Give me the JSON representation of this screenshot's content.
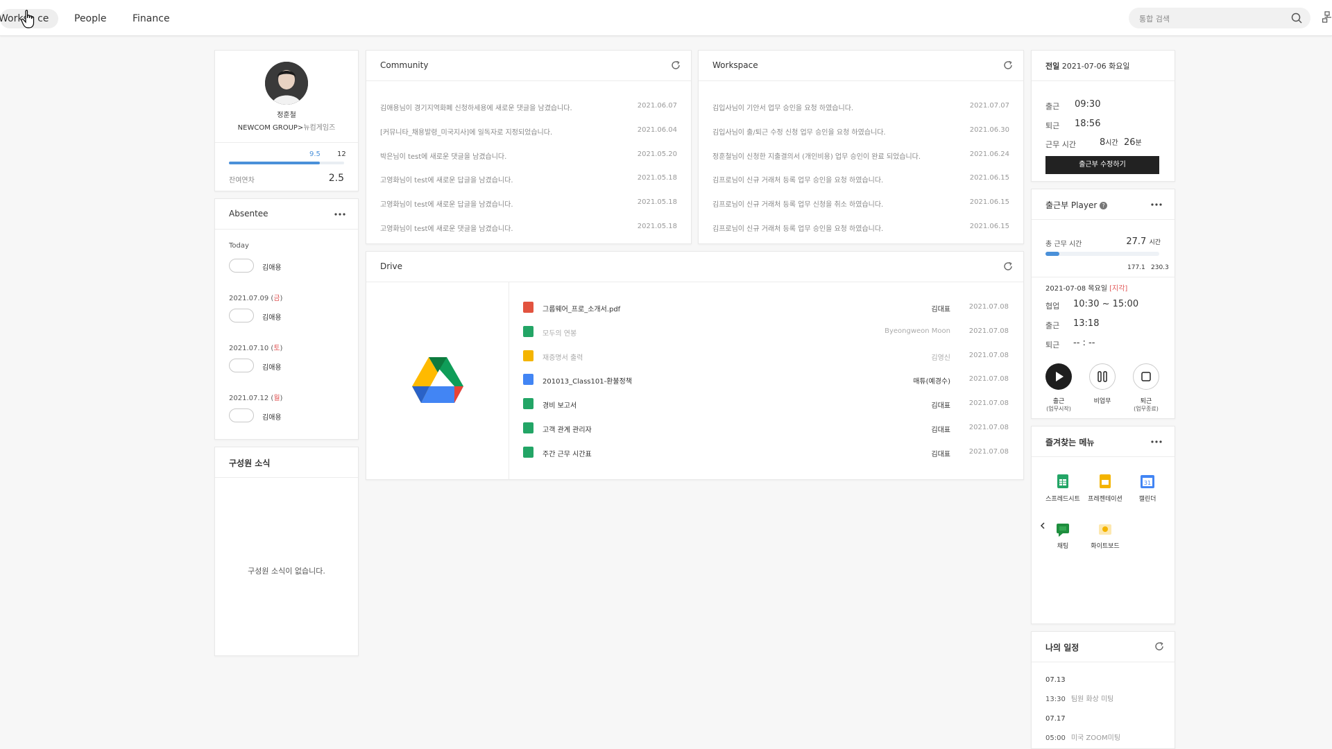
{
  "nav": {
    "tabs": [
      "Workspace",
      "People",
      "Finance"
    ],
    "active_visible": "Worksp ce"
  },
  "search": {
    "placeholder": "통합 검색"
  },
  "profile": {
    "name": "정훈철",
    "org": "NEWCOM GROUP>",
    "org_sub": "뉴컴게임즈",
    "leave_used": "9.5",
    "leave_total": "12",
    "leave_fraction": 0.79,
    "leave_label": "잔여연차",
    "leave_remaining": "2.5"
  },
  "absentee": {
    "title": "Absentee",
    "groups": [
      {
        "date": "Today",
        "date_suffix": "",
        "name": "김애용"
      },
      {
        "date": "2021.07.09 (",
        "date_suffix": "금",
        "date_close": ")",
        "name": "김애용"
      },
      {
        "date": "2021.07.10 (",
        "date_suffix": "토",
        "date_close": ")",
        "name": "김애용"
      },
      {
        "date": "2021.07.12 (",
        "date_suffix": "월",
        "date_close": ")",
        "name": "김애용"
      }
    ]
  },
  "news": {
    "title": "구성원 소식",
    "empty": "구성원 소식이 없습니다."
  },
  "community": {
    "title": "Community",
    "rows": [
      {
        "text": "김애용님이 경기지역화폐 신청하세용에 새로운 댓글을 남겼습니다.",
        "date": "2021.06.07"
      },
      {
        "text": "[커뮤니타_채용발령_미국지사]에 일독자로 지정되었습니다.",
        "date": "2021.06.04"
      },
      {
        "text": "박은님이 test에 새로운 댓글을 남겼습니다.",
        "date": "2021.05.20"
      },
      {
        "text": "고영화님이 test에 새로운 답글을 남겼습니다.",
        "date": "2021.05.18"
      },
      {
        "text": "고영화님이 test에 새로운 답글을 남겼습니다.",
        "date": "2021.05.18"
      },
      {
        "text": "고영화님이 test에 새로운 댓글을 남겼습니다.",
        "date": "2021.05.18"
      }
    ]
  },
  "workspace": {
    "title": "Workspace",
    "rows": [
      {
        "text": "김입사님이 기안서 업무 승인을 요청 하였습니다.",
        "date": "2021.07.07"
      },
      {
        "text": "김입사님이 출/퇴근 수정 신청 업무 승인을 요청 하였습니다.",
        "date": "2021.06.30"
      },
      {
        "text": "정훈철님이 신청한 지출결의서 (개인비용) 업무 승인이 완료 되었습니다.",
        "date": "2021.06.24"
      },
      {
        "text": "김프로님이 신규 거래처 등록 업무 승인을 요청 하였습니다.",
        "date": "2021.06.15"
      },
      {
        "text": "김프로님이 신규 거래처 등록 업무 신청을 취소 하였습니다.",
        "date": "2021.06.15"
      },
      {
        "text": "김프로님이 신규 거래처 등록 업무 승인을 요청 하였습니다.",
        "date": "2021.06.15"
      }
    ]
  },
  "drive": {
    "title": "Drive",
    "files": [
      {
        "icon": "pdf-file-icon",
        "name": "그룹웨어_프로_소개서.pdf",
        "owner": "김대표",
        "date": "2021.07.08",
        "dim": false,
        "color": "#e2533f"
      },
      {
        "icon": "sheets-file-icon",
        "name": "모두의 연봉",
        "owner": "Byeongweon Moon",
        "date": "2021.07.08",
        "dim": true,
        "color": "#23a566"
      },
      {
        "icon": "slides-file-icon",
        "name": "재증명서 출력",
        "owner": "김영신",
        "date": "2021.07.08",
        "dim": true,
        "color": "#f4b400"
      },
      {
        "icon": "docs-file-icon",
        "name": "201013_Class101-환불정책",
        "owner": "매튜(예경수)",
        "date": "2021.07.08",
        "dim": false,
        "color": "#4285f4"
      },
      {
        "icon": "sheets-file-icon",
        "name": "경비 보고서",
        "owner": "김대표",
        "date": "2021.07.08",
        "dim": false,
        "color": "#23a566"
      },
      {
        "icon": "sheets-file-icon",
        "name": "고객 관계 관리자",
        "owner": "김대표",
        "date": "2021.07.08",
        "dim": false,
        "color": "#23a566"
      },
      {
        "icon": "sheets-file-icon",
        "name": "주간 근무 시간표",
        "owner": "김대표",
        "date": "2021.07.08",
        "dim": false,
        "color": "#23a566"
      }
    ]
  },
  "attendance": {
    "title_prefix": "전일",
    "title_date": "2021-07-06 화요일",
    "in_label": "출근",
    "in_time": "09:30",
    "out_label": "퇴근",
    "out_time": "18:56",
    "work_label": "근무 시간",
    "work_h": "8",
    "work_h_unit": "시간",
    "work_m": "26",
    "work_m_unit": "분",
    "edit_button": "출근부 수정하기"
  },
  "player": {
    "title": "출근부 Player",
    "total_label": "총 근무 시간",
    "total_value": "27.7",
    "total_unit": "시간",
    "fraction": 0.12,
    "n1": "177.1",
    "n2": "230.3",
    "date": "2021-07-08 목요일",
    "date_tag": "[지각]",
    "rows": [
      {
        "label": "협업",
        "value": "10:30 ~ 15:00"
      },
      {
        "label": "출근",
        "value": "13:18"
      },
      {
        "label": "퇴근",
        "value": "-- : --"
      }
    ],
    "buttons": [
      {
        "label": "출근",
        "sub": "(업무시작)"
      },
      {
        "label": "비업무",
        "sub": ""
      },
      {
        "label": "퇴근",
        "sub": "(업무종료)"
      }
    ]
  },
  "favorites": {
    "title": "즐겨찾는 메뉴",
    "apps": [
      {
        "label": "스프레드시트",
        "color": "#23a566"
      },
      {
        "label": "프레젠테이션",
        "color": "#f4b400"
      },
      {
        "label": "캘린더",
        "color": "#4285f4"
      },
      {
        "label": "채팅",
        "color": "#1e8e3e"
      },
      {
        "label": "화이트보드",
        "color": "#f4b400"
      }
    ]
  },
  "schedule": {
    "title": "나의 일정",
    "items": [
      {
        "date": "07.13",
        "time": "13:30",
        "text": "팀원 화상 미팅"
      },
      {
        "date": "07.17",
        "time": "05:00",
        "text": "미국 ZOOM미팅"
      }
    ]
  }
}
